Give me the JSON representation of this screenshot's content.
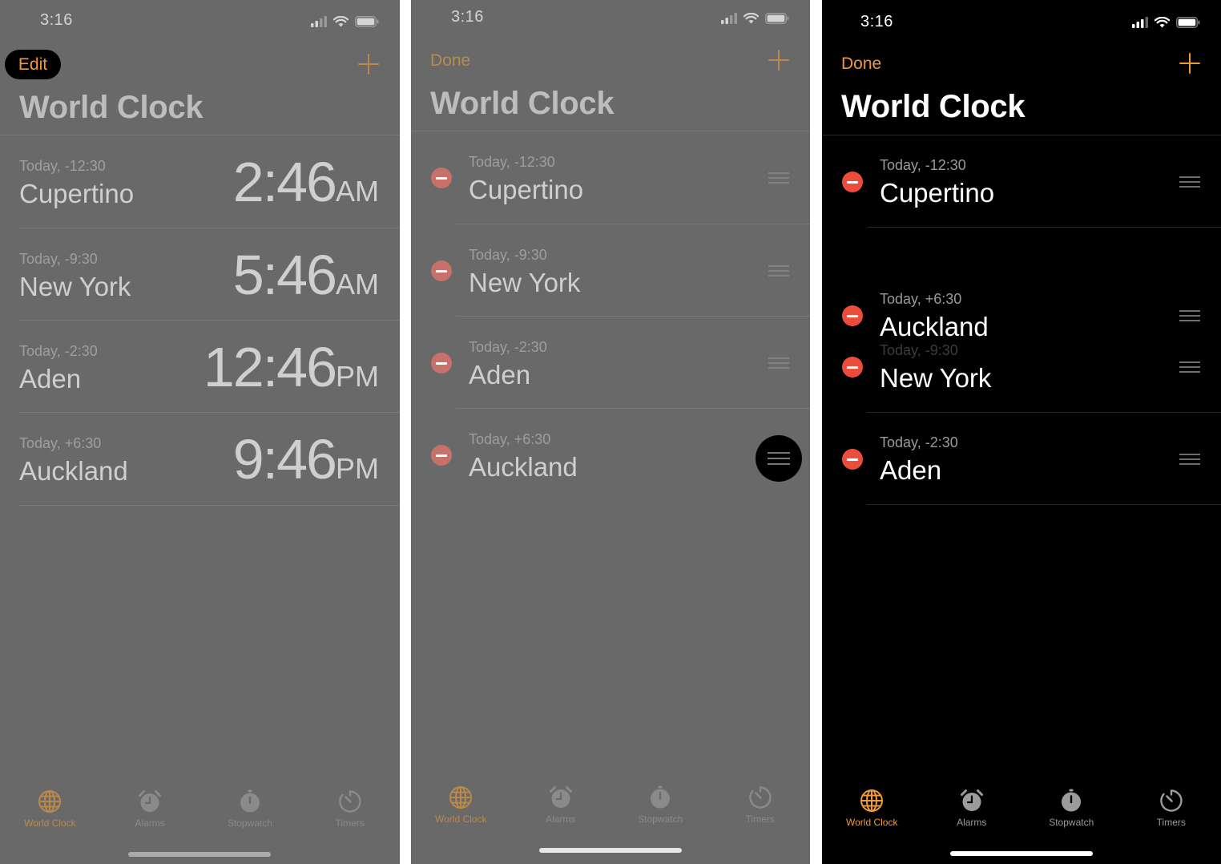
{
  "status": {
    "time": "3:16"
  },
  "colors": {
    "accent": "#f09a37",
    "dim_accent": "#b98a4a",
    "delete_red": "#eb4d3d",
    "dim_gray_bg": "#696969"
  },
  "icons": {
    "signal": "cellular-signal-icon",
    "wifi": "wifi-icon",
    "battery": "battery-icon",
    "delete": "minus-circle-icon",
    "reorder": "reorder-handle-icon",
    "world_clock": "globe-icon",
    "alarms": "alarm-clock-icon",
    "stopwatch": "stopwatch-icon",
    "timers": "timer-icon"
  },
  "screens": [
    {
      "nav": {
        "left_label": "Edit"
      },
      "title": "World Clock",
      "cities": [
        {
          "offset": "Today, -12:30",
          "name": "Cupertino",
          "time": "2:46",
          "ampm": "AM"
        },
        {
          "offset": "Today, -9:30",
          "name": "New York",
          "time": "5:46",
          "ampm": "AM"
        },
        {
          "offset": "Today, -2:30",
          "name": "Aden",
          "time": "12:46",
          "ampm": "PM"
        },
        {
          "offset": "Today, +6:30",
          "name": "Auckland",
          "time": "9:46",
          "ampm": "PM"
        }
      ]
    },
    {
      "nav": {
        "left_label": "Done"
      },
      "title": "World Clock",
      "cities": [
        {
          "offset": "Today, -12:30",
          "name": "Cupertino"
        },
        {
          "offset": "Today, -9:30",
          "name": "New York"
        },
        {
          "offset": "Today, -2:30",
          "name": "Aden"
        },
        {
          "offset": "Today, +6:30",
          "name": "Auckland"
        }
      ]
    },
    {
      "nav": {
        "left_label": "Done"
      },
      "title": "World Clock",
      "cities": [
        {
          "offset": "Today, -12:30",
          "name": "Cupertino"
        },
        {
          "offset": "Today, +6:30",
          "name": "Auckland"
        },
        {
          "offset": "Today, -9:30",
          "name": "New York"
        },
        {
          "offset": "Today, -2:30",
          "name": "Aden"
        }
      ]
    }
  ],
  "tabs": [
    {
      "label": "World Clock"
    },
    {
      "label": "Alarms"
    },
    {
      "label": "Stopwatch"
    },
    {
      "label": "Timers"
    }
  ]
}
